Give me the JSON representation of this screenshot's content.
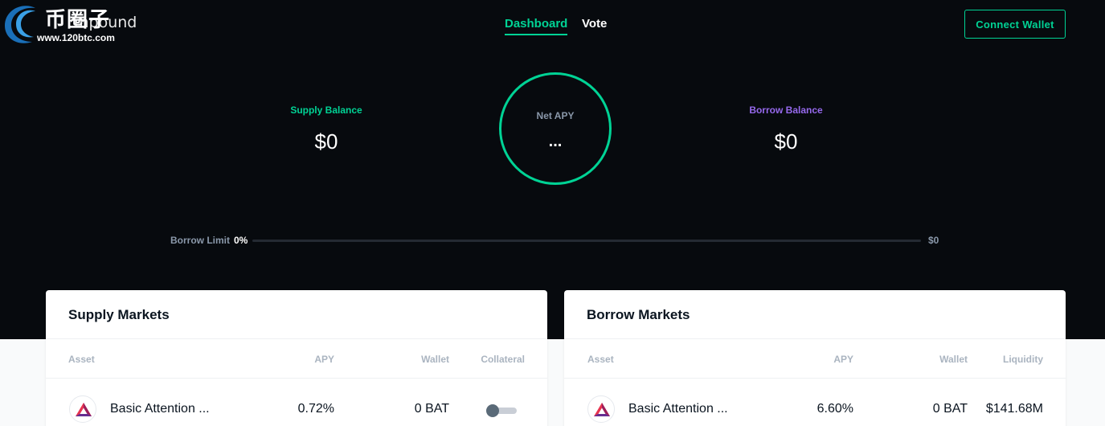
{
  "watermark": {
    "cn_text": "币圈子",
    "url": "www.120btc.com",
    "brand_partial": "mpound"
  },
  "nav": {
    "dashboard": "Dashboard",
    "vote": "Vote"
  },
  "header": {
    "connect_wallet": "Connect Wallet"
  },
  "balances": {
    "supply_label": "Supply Balance",
    "supply_value": "$0",
    "net_apy_label": "Net APY",
    "net_apy_value": "...",
    "borrow_label": "Borrow Balance",
    "borrow_value": "$0"
  },
  "borrow_limit": {
    "label": "Borrow Limit",
    "percent": "0%",
    "fill_fraction": 0,
    "amount": "$0"
  },
  "supply_markets": {
    "title": "Supply Markets",
    "columns": [
      "Asset",
      "APY",
      "Wallet",
      "Collateral"
    ],
    "rows": [
      {
        "asset": "Basic Attention ...",
        "apy": "0.72%",
        "wallet": "0 BAT",
        "collateral_enabled": false
      }
    ]
  },
  "borrow_markets": {
    "title": "Borrow Markets",
    "columns": [
      "Asset",
      "APY",
      "Wallet",
      "Liquidity"
    ],
    "rows": [
      {
        "asset": "Basic Attention ...",
        "apy": "6.60%",
        "wallet": "0 BAT",
        "liquidity": "$141.68M"
      }
    ]
  },
  "colors": {
    "accent_green": "#00d395",
    "accent_purple": "#9669ed",
    "hero_bg": "#070a0e",
    "bat_red": "#e8344f",
    "bat_purple": "#662d91"
  },
  "icons": {
    "asset": "bat-icon",
    "logo": "compound-logo-icon"
  }
}
